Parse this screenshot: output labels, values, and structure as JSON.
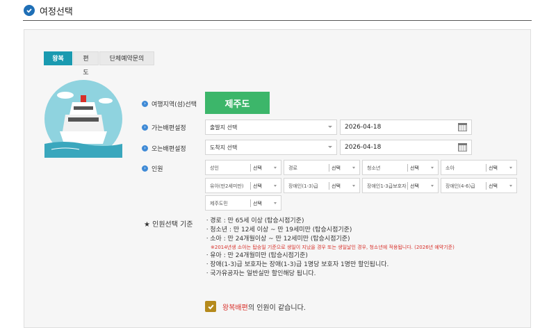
{
  "header": {
    "title": "여정선택"
  },
  "tabs": [
    {
      "label": "왕복",
      "active": true
    },
    {
      "label": "편도",
      "active": false
    },
    {
      "label": "단체예약문의",
      "active": false
    }
  ],
  "form": {
    "region_label": "여행지역(섬)선택",
    "region_value": "제주도",
    "departure_label": "가는배편설정",
    "departure_select": "출발지 선택",
    "departure_date": "2026-04-18",
    "return_label": "오는배편설정",
    "return_select": "도착지 선택",
    "return_date": "2026-04-18",
    "passenger_label": "인원"
  },
  "passengers": [
    {
      "label": "성인",
      "select": "선택"
    },
    {
      "label": "경로",
      "select": "선택"
    },
    {
      "label": "청소년",
      "select": "선택"
    },
    {
      "label": "소아",
      "select": "선택"
    },
    {
      "label": "유아(만2세미만)",
      "select": "선택"
    },
    {
      "label": "장애인(1-3)급",
      "select": "선택"
    },
    {
      "label": "장애인1-3급보호자",
      "select": "선택"
    },
    {
      "label": "장애인(4-6)급",
      "select": "선택"
    },
    {
      "label": "제주도민",
      "select": "선택"
    }
  ],
  "criteria": {
    "title": "★ 인원선택 기준",
    "items": [
      "ㆍ경로 : 만 65세 이상 (탑승시점기준)",
      "ㆍ청소년 : 만 12세 이상 ~ 만 19세미만 (탑승시점기준)",
      "ㆍ소아 : 만 24개월이상 ~ 만 12세미만 (탑승시점기준)"
    ],
    "note": "※2014년생 소아는 탑승일 기준으로 생일이 지났을 경우 또는 생일날인 경우, 청소년에 적용됩니다. (2026년 예약기준)",
    "items2": [
      "ㆍ유아 : 만 24개월미만 (탑승시점기준)",
      "ㆍ장애(1-3)급 보호자는 장애(1-3)급 1명당 보호자 1명만 할인됩니다.",
      "ㆍ국가유공자는 일반실만 할인해당 됩니다."
    ]
  },
  "agreement": {
    "highlight": "왕복배편",
    "text": "의 인원이 같습니다.",
    "checked": true
  },
  "colors": {
    "tab_active": "#1a9ab0",
    "region_button": "#3cb66a",
    "bullet": "#3f8ad6",
    "note_red": "#d8302a",
    "checkbox": "#b58a1c"
  }
}
